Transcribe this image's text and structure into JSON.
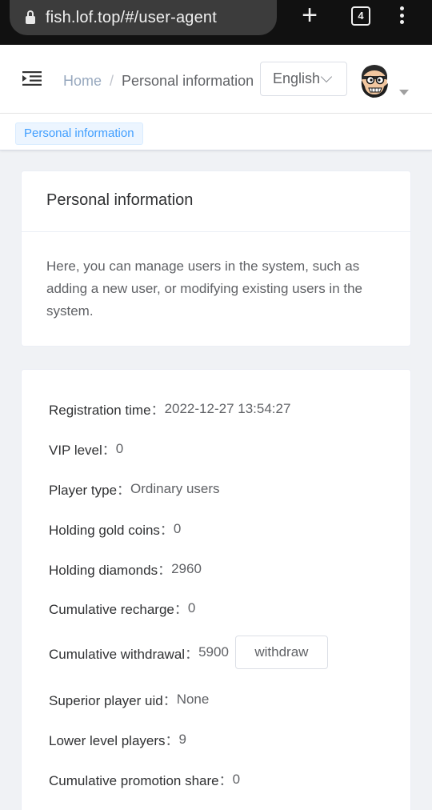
{
  "browser": {
    "url": "fish.lof.top/#/user-agent",
    "new_tab_icon": "plus-icon",
    "tab_count": "4",
    "menu_icon": "kebab-menu-icon",
    "lock_icon": "lock-icon"
  },
  "header": {
    "menu_icon": "hamburger-icon",
    "breadcrumb": {
      "home": "Home",
      "separator": "/",
      "current": "Personal information"
    },
    "language": "English",
    "avatar_icon": "avatar-icon",
    "dropdown_icon": "caret-down-icon"
  },
  "tags": {
    "active": "Personal information"
  },
  "intro_card": {
    "title": "Personal information",
    "description": "Here, you can manage users in the system, such as adding a new user, or modifying existing users in the system."
  },
  "profile": {
    "rows": [
      {
        "label": "Registration time",
        "value": "2022-12-27 13:54:27"
      },
      {
        "label": "VIP level",
        "value": "0"
      },
      {
        "label": "Player type",
        "value": "Ordinary users"
      },
      {
        "label": "Holding gold coins",
        "value": "0"
      },
      {
        "label": "Holding diamonds",
        "value": "2960"
      },
      {
        "label": "Cumulative recharge",
        "value": "0"
      },
      {
        "label": "Cumulative withdrawal",
        "value": "5900"
      },
      {
        "label": "Superior player uid",
        "value": "None"
      },
      {
        "label": "Lower level players",
        "value": "9"
      },
      {
        "label": "Cumulative promotion share",
        "value": "0"
      }
    ],
    "withdraw_label": "withdraw"
  },
  "colors": {
    "accent": "#409eff",
    "tag_bg": "#ecf5ff",
    "page_bg": "#f0f2f5"
  }
}
